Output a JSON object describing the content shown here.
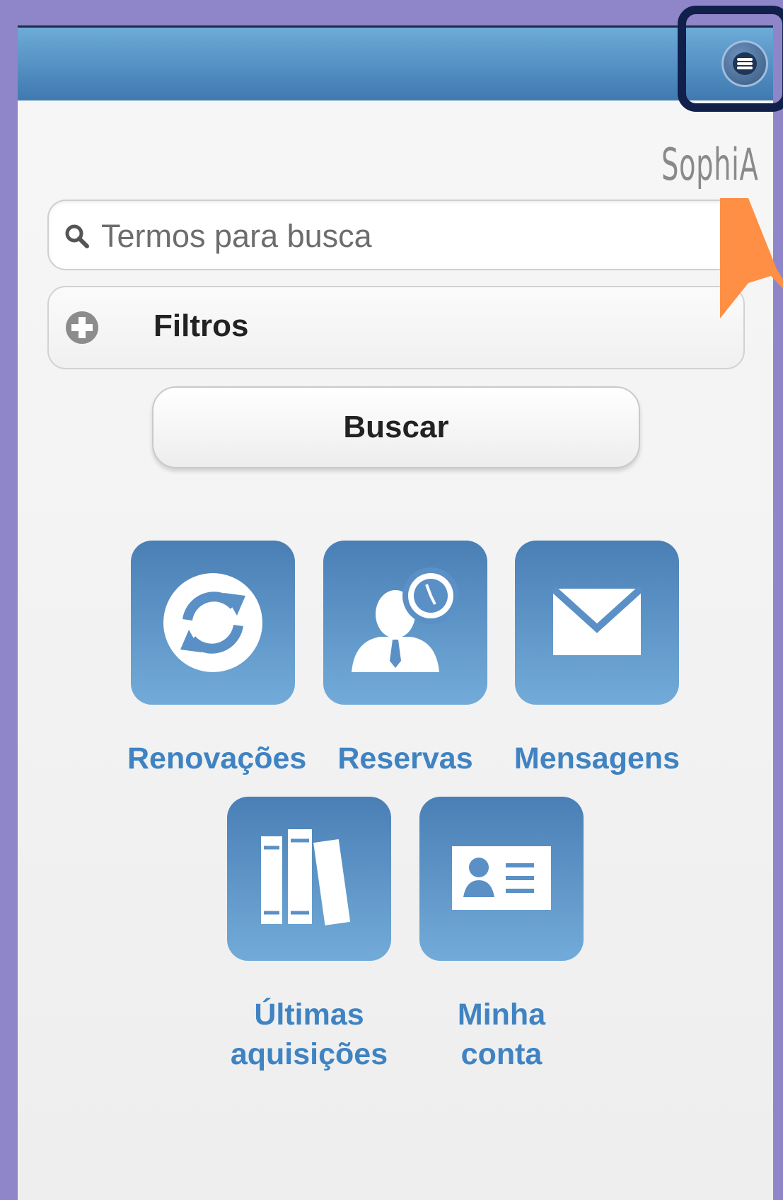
{
  "app": {
    "logo_text": "SophiA"
  },
  "search": {
    "placeholder": "Termos para busca"
  },
  "filters": {
    "label": "Filtros"
  },
  "actions": {
    "search_button": "Buscar"
  },
  "shortcuts": [
    {
      "label": "Renovações",
      "icon": "refresh-icon"
    },
    {
      "label": "Reservas",
      "icon": "person-clock-icon"
    },
    {
      "label": "Mensagens",
      "icon": "envelope-icon"
    },
    {
      "label_line1": "Últimas",
      "label_line2": "aquisições",
      "icon": "books-icon"
    },
    {
      "label_line1": "Minha",
      "label_line2": "conta",
      "icon": "id-card-icon"
    }
  ],
  "colors": {
    "header_top": "#6dabd8",
    "header_bottom": "#3f79b0",
    "tile_top": "#4a7fb5",
    "tile_bottom": "#72abd9",
    "label_blue": "#3f83c2",
    "highlight_frame": "#10204a",
    "orange_mark": "#ff8f45",
    "outer_background": "#8e86c9"
  }
}
